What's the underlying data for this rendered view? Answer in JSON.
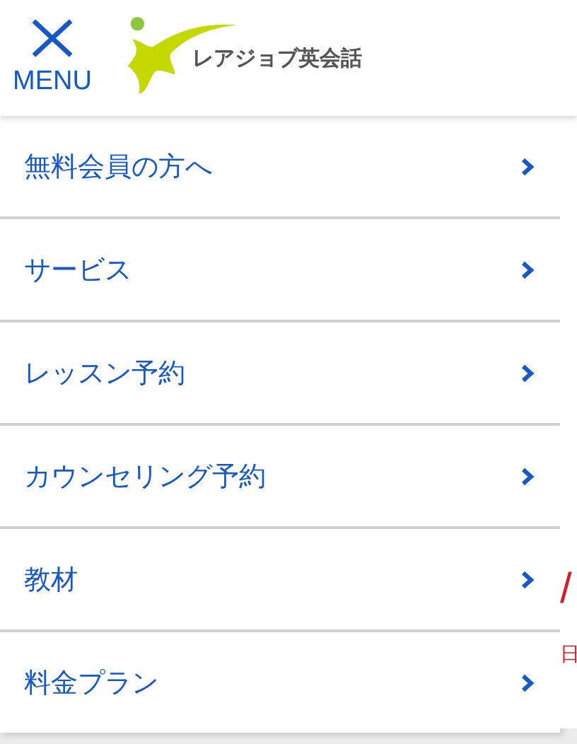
{
  "header": {
    "menu_label": "MENU",
    "logo_text": "レアジョブ英会話"
  },
  "menu": {
    "items": [
      {
        "label": "無料会員の方へ"
      },
      {
        "label": "サービス"
      },
      {
        "label": "レッスン予約"
      },
      {
        "label": "カウンセリング予約"
      },
      {
        "label": "教材"
      },
      {
        "label": "料金プラン"
      }
    ]
  },
  "background_peek": {
    "slash": "/",
    "day": "日"
  }
}
